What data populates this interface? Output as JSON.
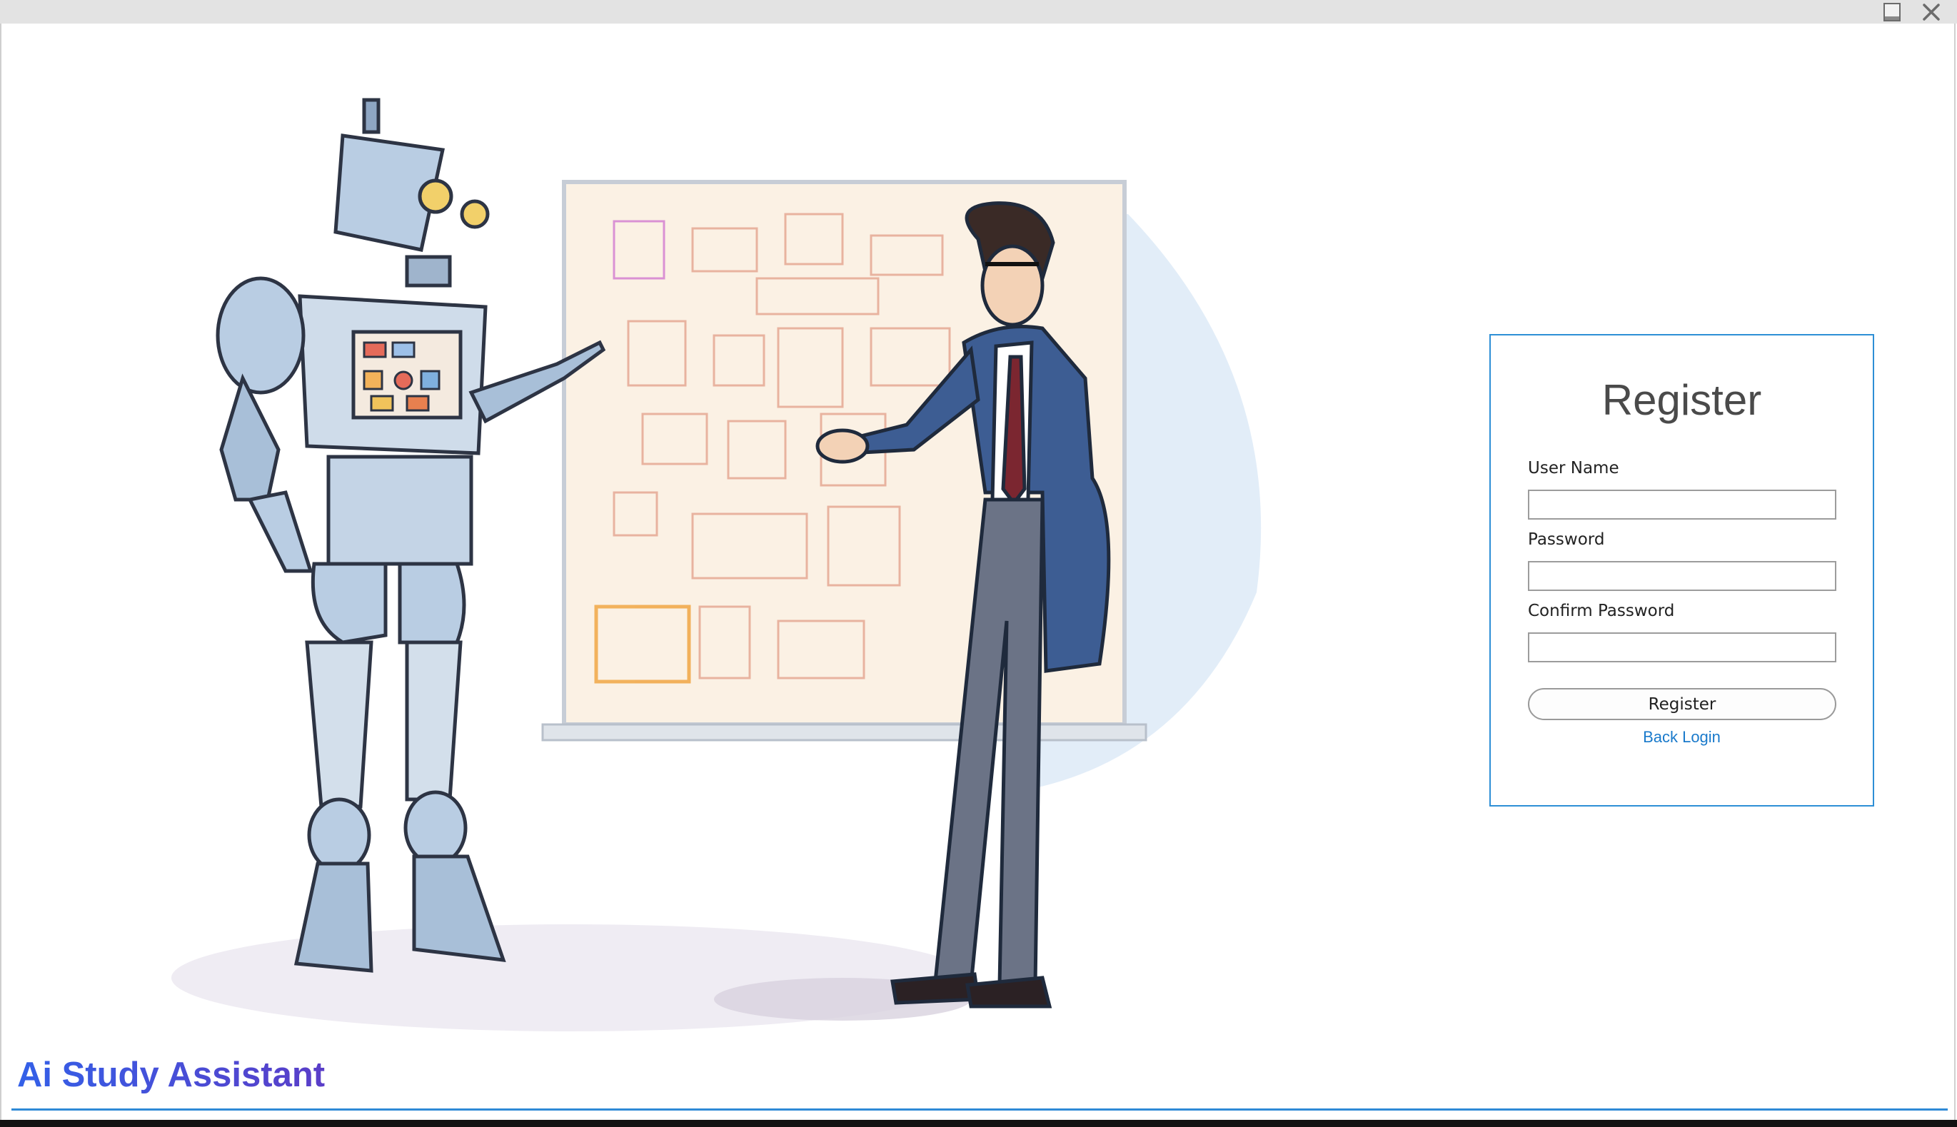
{
  "window": {
    "minimize_icon": "minimize-icon",
    "close_icon": "close-icon"
  },
  "app": {
    "title": "Ai Study Assistant"
  },
  "register": {
    "title": "Register",
    "username_label": "User Name",
    "username_value": "",
    "password_label": "Password",
    "password_value": "",
    "confirm_label": "Confirm Password",
    "confirm_value": "",
    "button_label": "Register",
    "back_link": "Back Login"
  },
  "colors": {
    "accent": "#2e8fd6",
    "link": "#1a7acb",
    "title_gradient_start": "#3360e8",
    "title_gradient_end": "#5a3ec8"
  }
}
